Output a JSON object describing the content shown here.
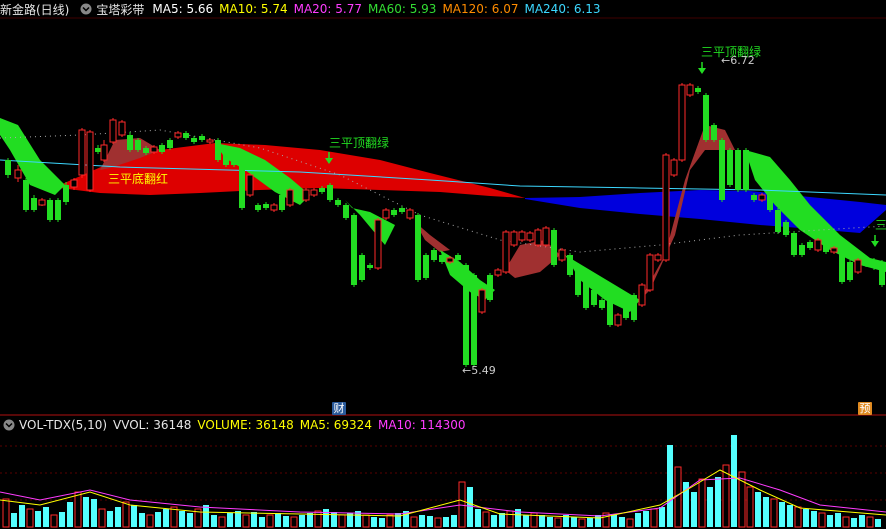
{
  "main_header": {
    "stock": "新金路(日线)",
    "indicator": "宝塔彩带",
    "mas": [
      {
        "label": "MA5:",
        "value": "5.66",
        "color": "#ffffff"
      },
      {
        "label": "MA10:",
        "value": "5.74",
        "color": "#ffff00"
      },
      {
        "label": "MA20:",
        "value": "5.77",
        "color": "#ff3cff"
      },
      {
        "label": "MA60:",
        "value": "5.93",
        "color": "#33dd33"
      },
      {
        "label": "MA120:",
        "value": "6.07",
        "color": "#ff8c00"
      },
      {
        "label": "MA240:",
        "value": "6.13",
        "color": "#3cd8ff"
      }
    ]
  },
  "volume_header": {
    "indicator": "VOL-TDX(5,10)",
    "items": [
      {
        "label": "VVOL:",
        "value": "36148",
        "color": "#e6e6e6"
      },
      {
        "label": "VOLUME:",
        "value": "36148",
        "color": "#ffff00"
      },
      {
        "label": "MA5:",
        "value": "69324",
        "color": "#ffff00"
      },
      {
        "label": "MA10:",
        "value": "114300",
        "color": "#ff3cff"
      }
    ]
  },
  "annotations": {
    "top_signal_1": "三平顶翻绿",
    "top_signal_2": "三平顶翻绿",
    "top_signal_3": "三",
    "bottom_signal": "三平底翻红",
    "high_label": "6.72",
    "low_label": "5.49",
    "arrow_glyph": "←"
  },
  "badges": {
    "finance": "财",
    "forecast": "预"
  },
  "colors": {
    "up": "#ff2a2a",
    "down": "#22dd22",
    "vol_down": "#54ffff",
    "band_red": "#dd0000",
    "band_blue": "#0000dd",
    "band_brown": "#a03030",
    "ma240": "#3cd8ff",
    "separator": "#b01010",
    "signal_top": "#22dd22",
    "signal_bottom": "#ffff00"
  }
}
